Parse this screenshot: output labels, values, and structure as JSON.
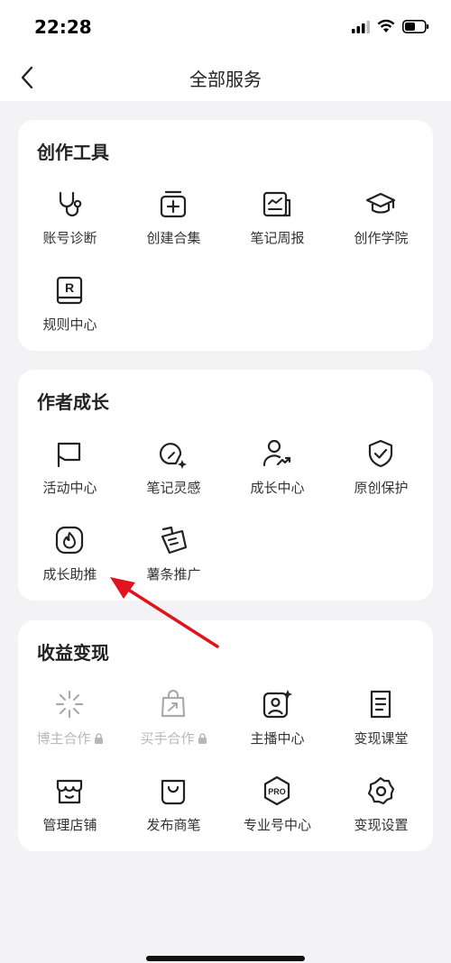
{
  "status_bar": {
    "time": "22:28"
  },
  "nav": {
    "title": "全部服务"
  },
  "sections": [
    {
      "title": "创作工具",
      "items": [
        {
          "label": "账号诊断",
          "icon": "stethoscope-icon"
        },
        {
          "label": "创建合集",
          "icon": "add-collection-icon"
        },
        {
          "label": "笔记周报",
          "icon": "weekly-report-icon"
        },
        {
          "label": "创作学院",
          "icon": "graduation-cap-icon"
        },
        {
          "label": "规则中心",
          "icon": "rules-icon"
        }
      ]
    },
    {
      "title": "作者成长",
      "items": [
        {
          "label": "活动中心",
          "icon": "flag-icon"
        },
        {
          "label": "笔记灵感",
          "icon": "lightbulb-icon"
        },
        {
          "label": "成长中心",
          "icon": "user-growth-icon"
        },
        {
          "label": "原创保护",
          "icon": "shield-check-icon"
        },
        {
          "label": "成长助推",
          "icon": "flame-icon"
        },
        {
          "label": "薯条推广",
          "icon": "fries-icon"
        }
      ]
    },
    {
      "title": "收益变现",
      "items": [
        {
          "label": "博主合作",
          "icon": "sparkle-icon",
          "locked": true
        },
        {
          "label": "买手合作",
          "icon": "shopping-bag-arrow-icon",
          "locked": true
        },
        {
          "label": "主播中心",
          "icon": "live-host-icon"
        },
        {
          "label": "变现课堂",
          "icon": "document-icon"
        },
        {
          "label": "管理店铺",
          "icon": "store-icon"
        },
        {
          "label": "发布商笔",
          "icon": "bag-icon"
        },
        {
          "label": "专业号中心",
          "icon": "pro-badge-icon"
        },
        {
          "label": "变现设置",
          "icon": "settings-gear-icon"
        }
      ]
    }
  ],
  "colors": {
    "annotation_arrow": "#e0141e",
    "disabled": "#b8b8b8"
  }
}
